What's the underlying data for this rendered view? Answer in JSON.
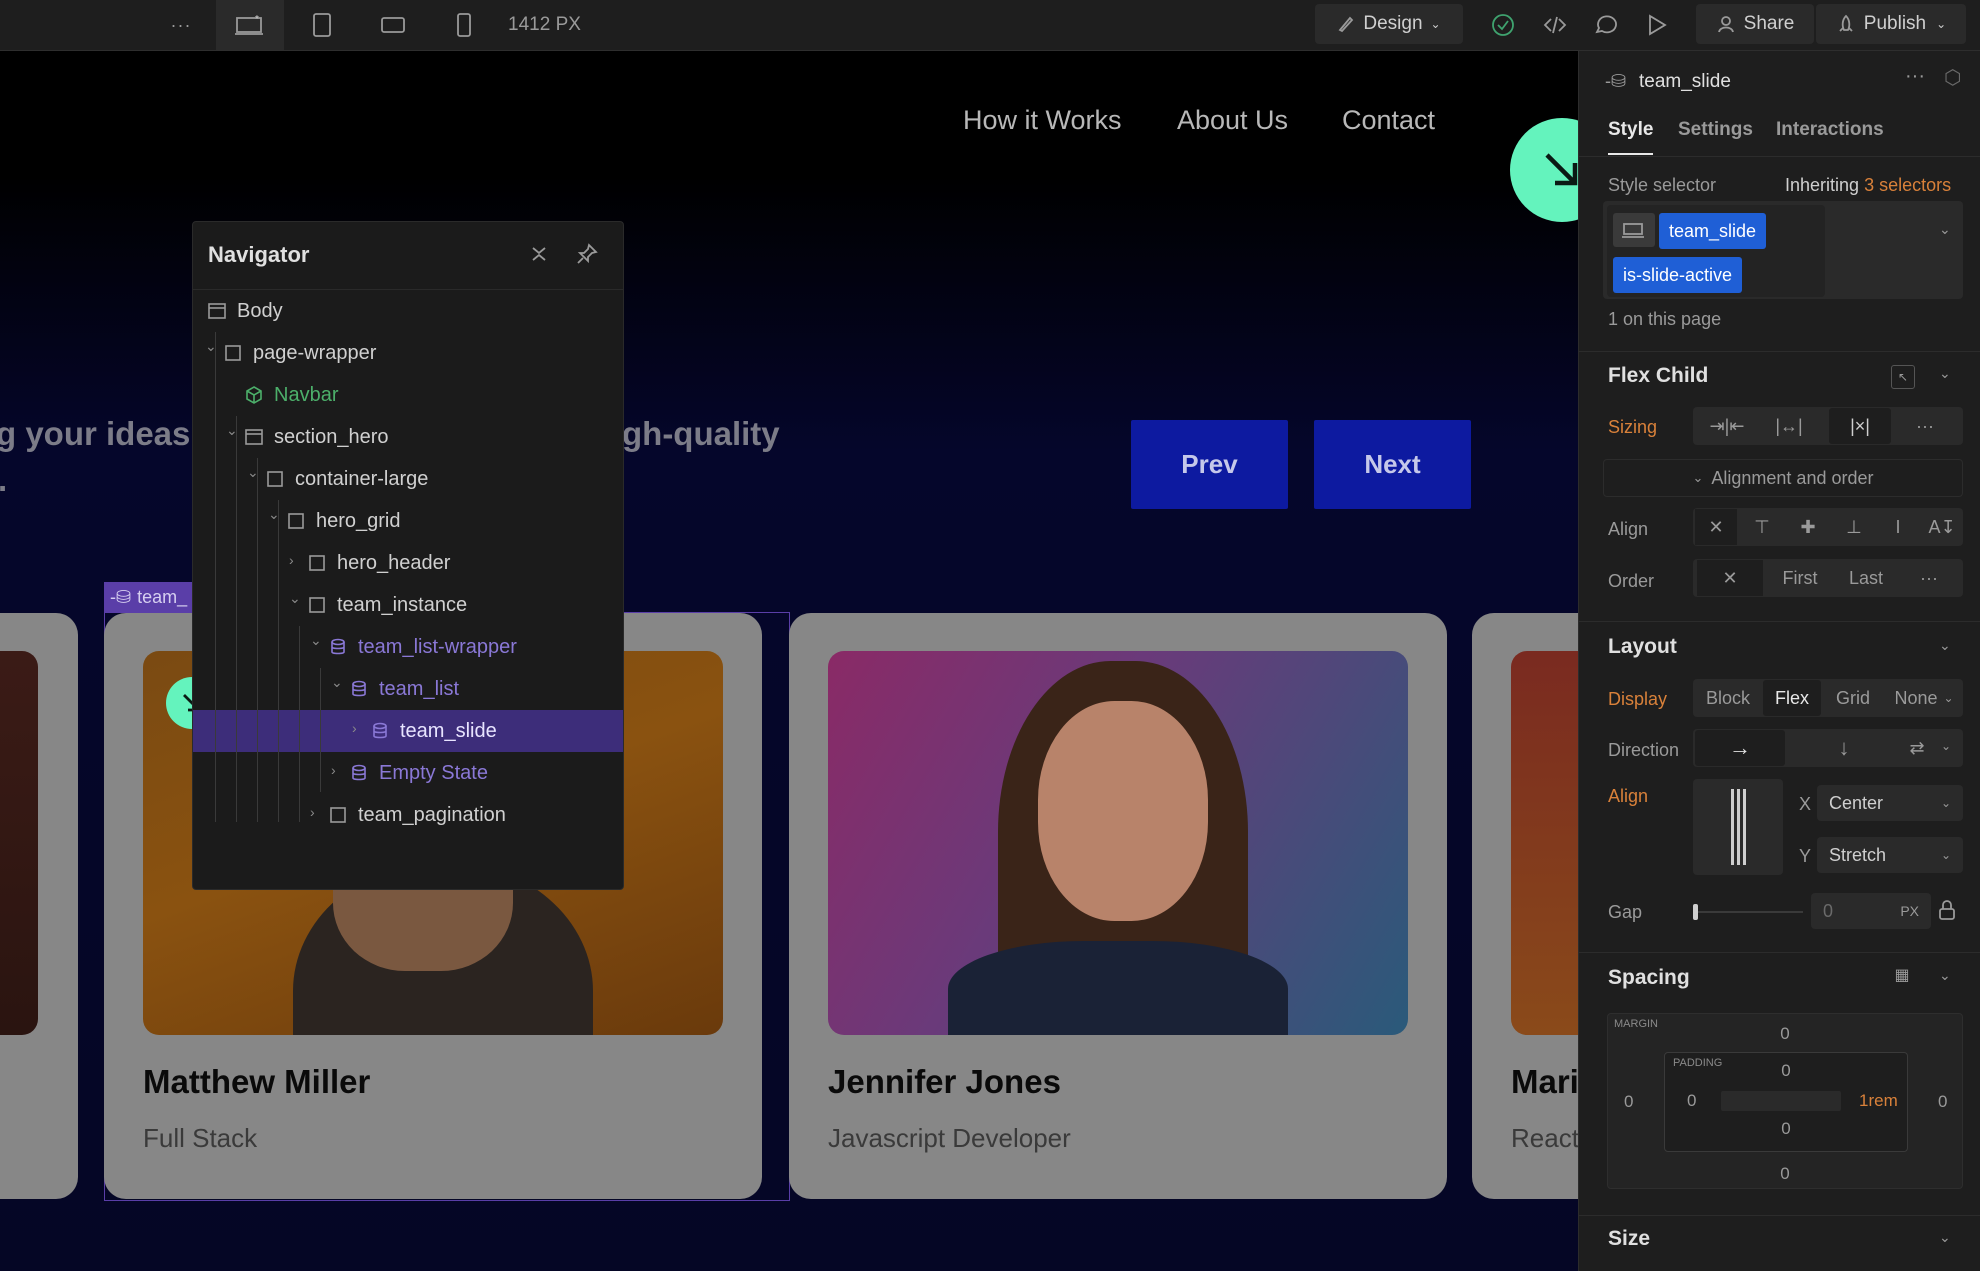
{
  "topbar": {
    "more": "···",
    "viewport_width": "1412",
    "viewport_unit": "PX",
    "design_label": "Design",
    "share_label": "Share",
    "publish_label": "Publish"
  },
  "site": {
    "nav_links": [
      "How it Works",
      "About Us",
      "Contact"
    ],
    "hero_line1_left": "g your ideas",
    "hero_line1_right": "gh-quality",
    "hero_line2_left": ".",
    "prev_label": "Prev",
    "next_label": "Next",
    "selected_tag": "team_",
    "cards": [
      {
        "name": "Matthew Miller",
        "role": "Full Stack"
      },
      {
        "name": "Jennifer Jones",
        "role": "Javascript Developer"
      },
      {
        "name": "Mari",
        "role": "React"
      }
    ]
  },
  "navigator": {
    "title": "Navigator",
    "items": [
      {
        "label": "Body",
        "depth": 0,
        "kind": "body"
      },
      {
        "label": "page-wrapper",
        "depth": 0,
        "kind": "box"
      },
      {
        "label": "Navbar",
        "depth": 1,
        "kind": "component"
      },
      {
        "label": "section_hero",
        "depth": 1,
        "kind": "section"
      },
      {
        "label": "container-large",
        "depth": 2,
        "kind": "box"
      },
      {
        "label": "hero_grid",
        "depth": 3,
        "kind": "box"
      },
      {
        "label": "hero_header",
        "depth": 4,
        "kind": "box"
      },
      {
        "label": "team_instance",
        "depth": 4,
        "kind": "box"
      },
      {
        "label": "team_list-wrapper",
        "depth": 5,
        "kind": "cms"
      },
      {
        "label": "team_list",
        "depth": 6,
        "kind": "cms"
      },
      {
        "label": "team_slide",
        "depth": 7,
        "kind": "cms"
      },
      {
        "label": "Empty State",
        "depth": 6,
        "kind": "cms"
      },
      {
        "label": "team_pagination",
        "depth": 5,
        "kind": "box"
      }
    ]
  },
  "panel": {
    "element_name": "team_slide",
    "tabs": [
      "Style",
      "Settings",
      "Interactions"
    ],
    "style_selector_label": "Style selector",
    "inheriting_label": "Inheriting",
    "inheriting_count": "3 selectors",
    "selectors": [
      "team_slide",
      "is-slide-active"
    ],
    "on_page": "1 on this page",
    "flex_child": {
      "title": "Flex Child",
      "sizing_label": "Sizing",
      "alignment_toggle": "Alignment and order",
      "align_label": "Align",
      "order_label": "Order",
      "order_options": [
        "First",
        "Last"
      ]
    },
    "layout": {
      "title": "Layout",
      "display_label": "Display",
      "display_options": [
        "Block",
        "Flex",
        "Grid",
        "None"
      ],
      "direction_label": "Direction",
      "align_label": "Align",
      "x_label": "X",
      "x_value": "Center",
      "y_label": "Y",
      "y_value": "Stretch",
      "gap_label": "Gap",
      "gap_value": "0",
      "gap_unit": "PX"
    },
    "spacing": {
      "title": "Spacing",
      "margin_label": "MARGIN",
      "padding_label": "PADDING",
      "margin": {
        "top": "0",
        "right": "0",
        "bottom": "0",
        "left": "0"
      },
      "padding": {
        "top": "0",
        "right": "1rem",
        "bottom": "0",
        "left": "0"
      }
    },
    "size_title": "Size"
  },
  "colors": {
    "accent_purple": "#5a3ea8",
    "selector_blue": "#1f5fd6",
    "cursor_green": "#64f3bd",
    "orange": "#d9813a"
  }
}
